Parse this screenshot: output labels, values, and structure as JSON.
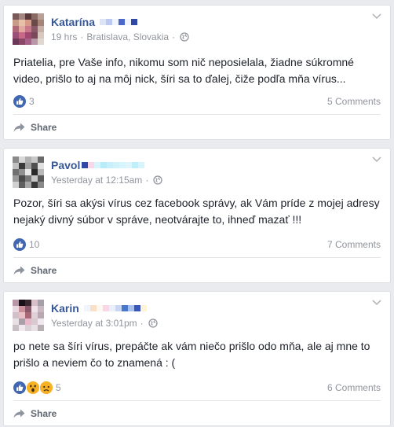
{
  "posts": [
    {
      "author": "Katarína",
      "time": "19 hrs",
      "location": "Bratislava, Slovakia",
      "text": "Priatelia, pre Vaše info, nikomu som nič neposielala, žiadne súkromné video, prišlo to aj na môj nick, šíri sa to ďalej, čiže podľa mňa vírus...",
      "reaction_count": "3",
      "comments": "5 Comments",
      "share_label": "Share"
    },
    {
      "author": "Pavol",
      "time": "Yesterday at 12:15am",
      "text": "Pozor, šíri sa akýsi vírus cez facebook správy, ak Vám príde z mojej adresy nejaký divný súbor v správe, neotvárajte to, ihneď mazať !!!",
      "reaction_count": "10",
      "comments": "7 Comments",
      "share_label": "Share"
    },
    {
      "author": "Karin",
      "time": "Yesterday at 3:01pm",
      "text": "po nete sa šíri vírus, prepáčte ak vám niečo prišlo odo mňa, ale aj mne to prišlo a neviem čo to znamená : (",
      "reaction_count": "5",
      "comments": "6 Comments",
      "share_label": "Share"
    }
  ],
  "colors": {
    "link_blue": "#365899",
    "like_blue": "#4267b2",
    "meta_gray": "#90949c",
    "background": "#e9ebee"
  },
  "icons": [
    "globe-icon",
    "chevron-down-icon",
    "like-icon",
    "wow-icon",
    "sad-icon",
    "share-icon"
  ]
}
